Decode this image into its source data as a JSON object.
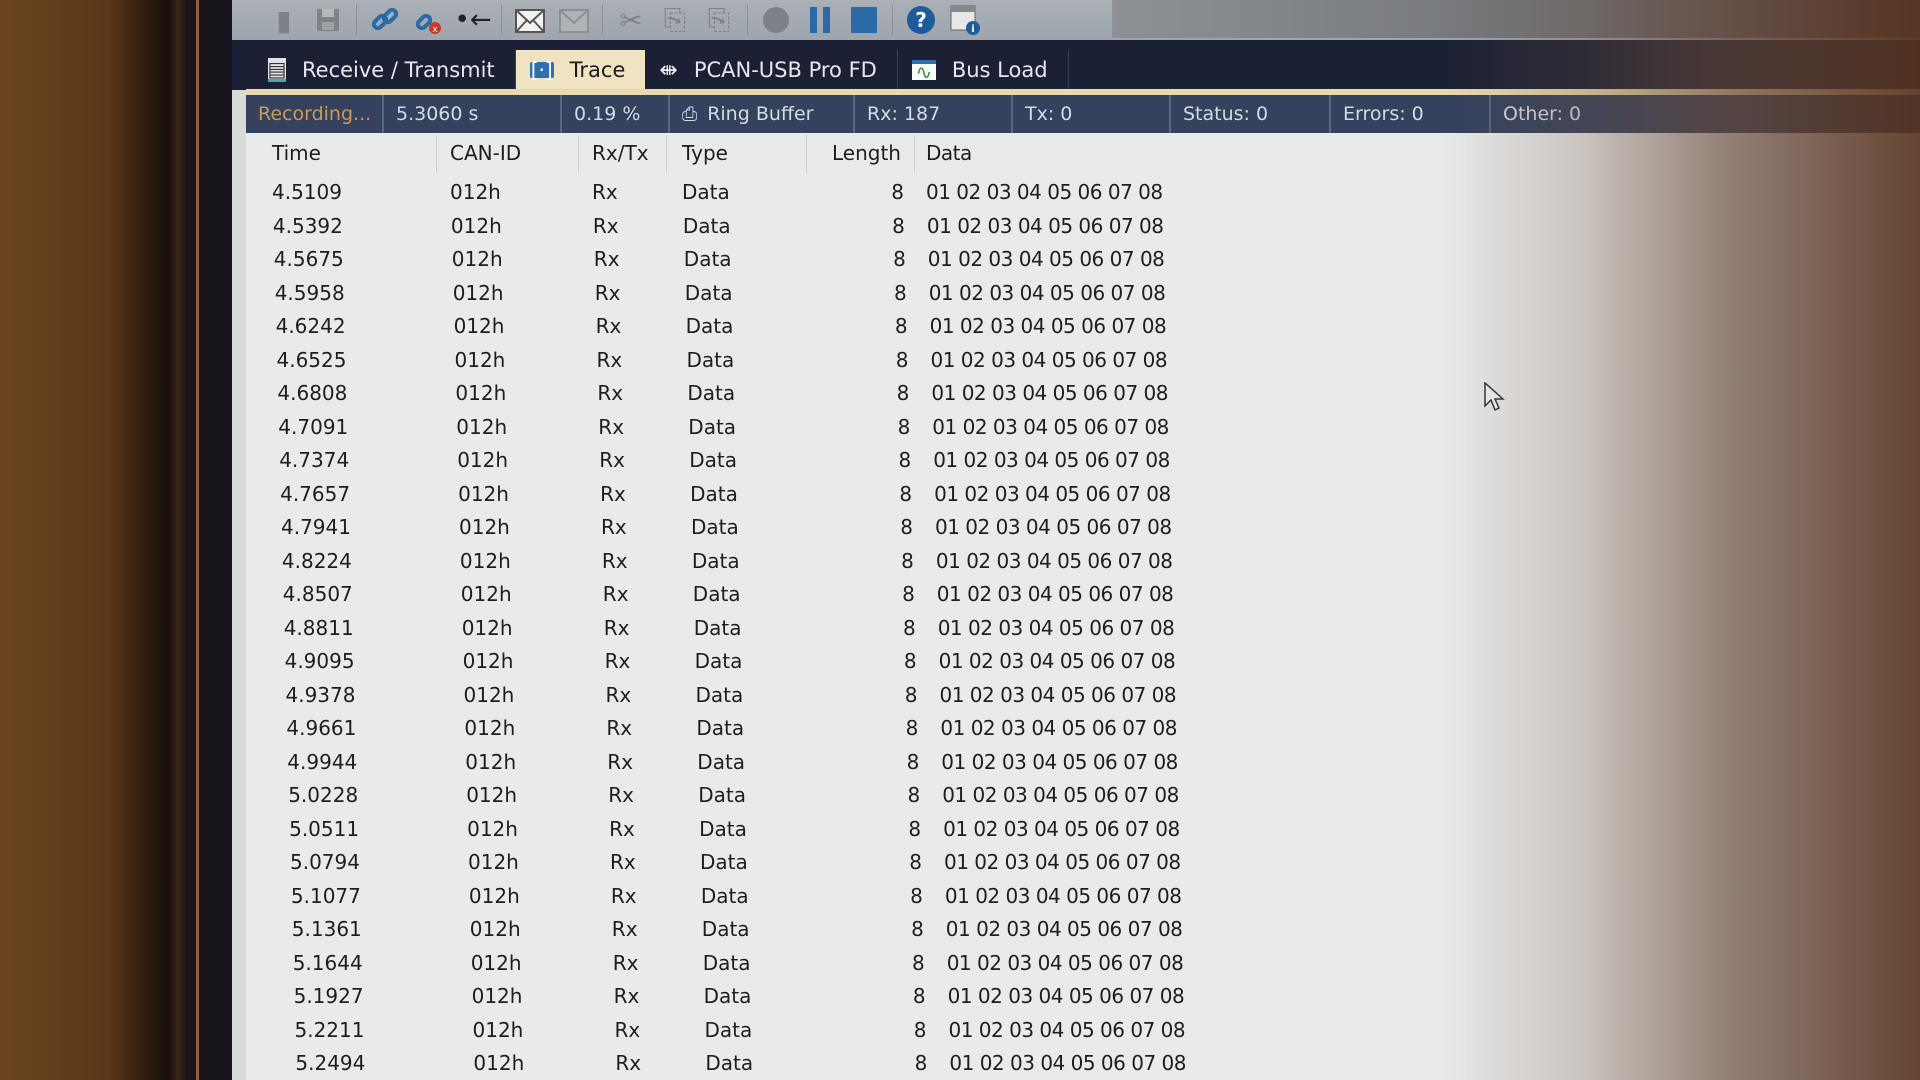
{
  "toolbar": {
    "icons": [
      {
        "name": "connect-icon-dim",
        "glyph": "▮"
      },
      {
        "name": "save-icon",
        "glyph": "💾"
      },
      {
        "name": "connect-icon",
        "glyph": "⛓"
      },
      {
        "name": "disconnect-icon",
        "glyph": "⛓"
      },
      {
        "name": "reset-icon",
        "glyph": "•←"
      },
      {
        "name": "new-message-icon",
        "glyph": "✉"
      },
      {
        "name": "edit-message-icon",
        "glyph": "✉"
      },
      {
        "name": "cut-icon",
        "glyph": "✂"
      },
      {
        "name": "copy-icon",
        "glyph": "⎘"
      },
      {
        "name": "paste-icon",
        "glyph": "⎘"
      },
      {
        "name": "record-icon",
        "glyph": "●"
      },
      {
        "name": "pause-icon",
        "glyph": "❚❚"
      },
      {
        "name": "stop-icon",
        "glyph": "■"
      },
      {
        "name": "help-icon",
        "glyph": "?"
      },
      {
        "name": "info-icon",
        "glyph": "ℹ"
      }
    ]
  },
  "tabs": [
    {
      "label": "Receive / Transmit",
      "icon": "receive-transmit-icon",
      "active": false
    },
    {
      "label": "Trace",
      "icon": "trace-icon",
      "active": true
    },
    {
      "label": "PCAN-USB Pro FD",
      "icon": "usb-icon",
      "active": false
    },
    {
      "label": "Bus Load",
      "icon": "bus-load-icon",
      "active": false
    }
  ],
  "status": {
    "recording": "Recording...",
    "elapsed": "5.3060 s",
    "buffer_fill": "0.19 %",
    "buffer_mode": "Ring Buffer",
    "rx": "Rx: 187",
    "tx": "Tx: 0",
    "status": "Status: 0",
    "errors": "Errors: 0",
    "other": "Other: 0"
  },
  "table": {
    "columns": [
      "Time",
      "CAN-ID",
      "Rx/Tx",
      "Type",
      "Length",
      "Data"
    ],
    "rows": [
      [
        "4.5109",
        "012h",
        "Rx",
        "Data",
        "8",
        "01 02 03 04 05 06 07 08"
      ],
      [
        "4.5392",
        "012h",
        "Rx",
        "Data",
        "8",
        "01 02 03 04 05 06 07 08"
      ],
      [
        "4.5675",
        "012h",
        "Rx",
        "Data",
        "8",
        "01 02 03 04 05 06 07 08"
      ],
      [
        "4.5958",
        "012h",
        "Rx",
        "Data",
        "8",
        "01 02 03 04 05 06 07 08"
      ],
      [
        "4.6242",
        "012h",
        "Rx",
        "Data",
        "8",
        "01 02 03 04 05 06 07 08"
      ],
      [
        "4.6525",
        "012h",
        "Rx",
        "Data",
        "8",
        "01 02 03 04 05 06 07 08"
      ],
      [
        "4.6808",
        "012h",
        "Rx",
        "Data",
        "8",
        "01 02 03 04 05 06 07 08"
      ],
      [
        "4.7091",
        "012h",
        "Rx",
        "Data",
        "8",
        "01 02 03 04 05 06 07 08"
      ],
      [
        "4.7374",
        "012h",
        "Rx",
        "Data",
        "8",
        "01 02 03 04 05 06 07 08"
      ],
      [
        "4.7657",
        "012h",
        "Rx",
        "Data",
        "8",
        "01 02 03 04 05 06 07 08"
      ],
      [
        "4.7941",
        "012h",
        "Rx",
        "Data",
        "8",
        "01 02 03 04 05 06 07 08"
      ],
      [
        "4.8224",
        "012h",
        "Rx",
        "Data",
        "8",
        "01 02 03 04 05 06 07 08"
      ],
      [
        "4.8507",
        "012h",
        "Rx",
        "Data",
        "8",
        "01 02 03 04 05 06 07 08"
      ],
      [
        "4.8811",
        "012h",
        "Rx",
        "Data",
        "8",
        "01 02 03 04 05 06 07 08"
      ],
      [
        "4.9095",
        "012h",
        "Rx",
        "Data",
        "8",
        "01 02 03 04 05 06 07 08"
      ],
      [
        "4.9378",
        "012h",
        "Rx",
        "Data",
        "8",
        "01 02 03 04 05 06 07 08"
      ],
      [
        "4.9661",
        "012h",
        "Rx",
        "Data",
        "8",
        "01 02 03 04 05 06 07 08"
      ],
      [
        "4.9944",
        "012h",
        "Rx",
        "Data",
        "8",
        "01 02 03 04 05 06 07 08"
      ],
      [
        "5.0228",
        "012h",
        "Rx",
        "Data",
        "8",
        "01 02 03 04 05 06 07 08"
      ],
      [
        "5.0511",
        "012h",
        "Rx",
        "Data",
        "8",
        "01 02 03 04 05 06 07 08"
      ],
      [
        "5.0794",
        "012h",
        "Rx",
        "Data",
        "8",
        "01 02 03 04 05 06 07 08"
      ],
      [
        "5.1077",
        "012h",
        "Rx",
        "Data",
        "8",
        "01 02 03 04 05 06 07 08"
      ],
      [
        "5.1361",
        "012h",
        "Rx",
        "Data",
        "8",
        "01 02 03 04 05 06 07 08"
      ],
      [
        "5.1644",
        "012h",
        "Rx",
        "Data",
        "8",
        "01 02 03 04 05 06 07 08"
      ],
      [
        "5.1927",
        "012h",
        "Rx",
        "Data",
        "8",
        "01 02 03 04 05 06 07 08"
      ],
      [
        "5.2211",
        "012h",
        "Rx",
        "Data",
        "8",
        "01 02 03 04 05 06 07 08"
      ],
      [
        "5.2494",
        "012h",
        "Rx",
        "Data",
        "8",
        "01 02 03 04 05 06 07 08"
      ]
    ]
  },
  "colors": {
    "tab_bar_bg": "#1b2035",
    "active_tab_bg": "#efe3c2",
    "status_bar_bg": "#34425e",
    "recording_text": "#c99a5a",
    "table_bg": "#e9eaea"
  }
}
